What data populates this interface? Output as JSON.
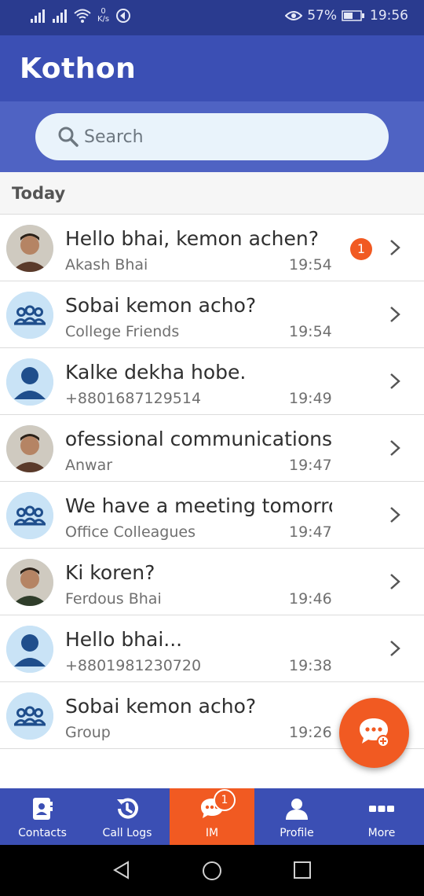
{
  "status_bar": {
    "net_speed_value": "0",
    "net_speed_unit": "K/s",
    "battery": "57%",
    "time": "19:56",
    "icons": [
      "signal-icon",
      "signal-icon",
      "wifi-icon",
      "data-saver-icon",
      "eye-comfort-icon",
      "battery-icon"
    ]
  },
  "header": {
    "title": "Kothon"
  },
  "search": {
    "placeholder": "Search"
  },
  "section": {
    "label": "Today"
  },
  "conversations": [
    {
      "message": "Hello bhai, kemon achen?",
      "sender": "Akash Bhai",
      "time": "19:54",
      "unread": "1",
      "avatar": "photo"
    },
    {
      "message": "Sobai kemon acho?",
      "sender": "College Friends",
      "time": "19:54",
      "avatar": "group"
    },
    {
      "message": "Kalke dekha hobe.",
      "sender": "+8801687129514",
      "time": "19:49",
      "avatar": "person"
    },
    {
      "message": "ofessional communications.",
      "sender": "Anwar",
      "time": "19:47",
      "avatar": "photo"
    },
    {
      "message": "We have a meeting tomorro",
      "sender": "Office Colleagues",
      "time": "19:47",
      "avatar": "group"
    },
    {
      "message": "Ki koren?",
      "sender": "Ferdous Bhai",
      "time": "19:46",
      "avatar": "photo"
    },
    {
      "message": "Hello bhai...",
      "sender": "+8801981230720",
      "time": "19:38",
      "avatar": "person"
    },
    {
      "message": "Sobai kemon acho?",
      "sender": "Group",
      "time": "19:26",
      "avatar": "group"
    }
  ],
  "bottom_nav": [
    {
      "label": "Contacts",
      "icon": "contacts-icon"
    },
    {
      "label": "Call Logs",
      "icon": "call-logs-icon"
    },
    {
      "label": "IM",
      "icon": "chat-icon",
      "badge": "1",
      "active": true
    },
    {
      "label": "Profile",
      "icon": "profile-icon"
    },
    {
      "label": "More",
      "icon": "more-icon"
    }
  ],
  "colors": {
    "primary": "#3b4fb4",
    "status_bar": "#2a3b8f",
    "accent": "#f15a22",
    "avatar_bg": "#c9e3f6",
    "avatar_fg": "#1f4e8c"
  }
}
